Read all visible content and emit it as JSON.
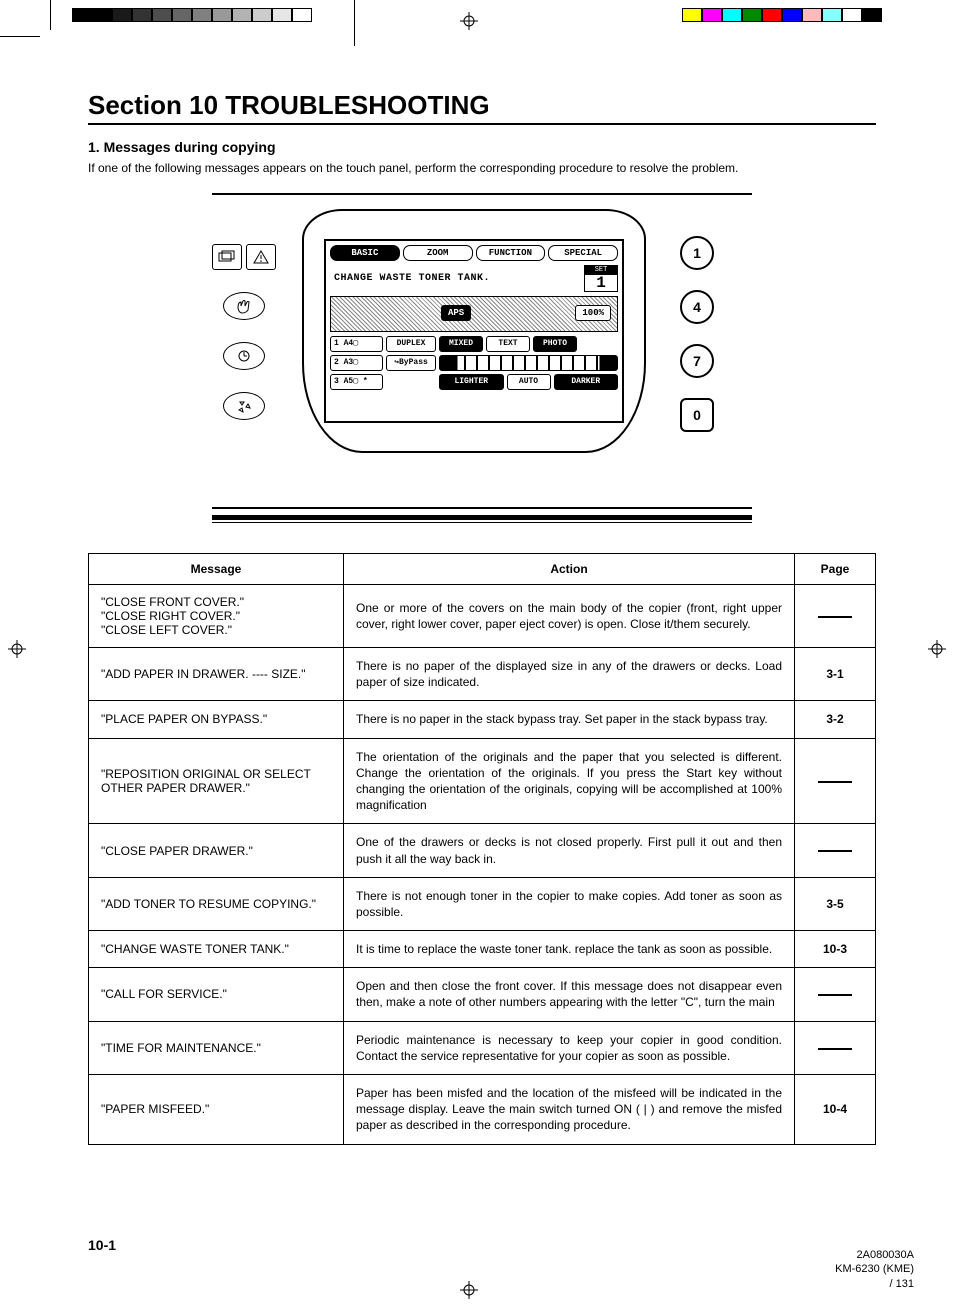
{
  "header": {
    "section_title": "Section 10  TROUBLESHOOTING",
    "sub_heading": "1. Messages during copying",
    "intro_text": "If one of the following messages appears on the touch panel, perform the corresponding procedure to resolve the problem."
  },
  "panel": {
    "tabs": [
      "BASIC",
      "ZOOM",
      "FUNCTION",
      "SPECIAL"
    ],
    "active_tab": 0,
    "message": "CHANGE WASTE TONER TANK.",
    "set_label": "SET",
    "set_value": "1",
    "aps_label": "APS",
    "ratio_label": "100%",
    "paper_slots": [
      "1 A4▢",
      "2 A3▢",
      "3 A5▢ *"
    ],
    "options_row1": [
      "DUPLEX",
      "MIXED",
      "TEXT",
      "PHOTO"
    ],
    "options_row2_left": "↪ByPass",
    "options_row3": [
      "LIGHTER",
      "AUTO",
      "DARKER"
    ],
    "left_icons": [
      "page-stack-icon",
      "hand-icon",
      "clock-icon",
      "recycle-icon"
    ],
    "num_buttons": [
      "1",
      "4",
      "7",
      "0"
    ]
  },
  "table": {
    "headers": {
      "message": "Message",
      "action": "Action",
      "page": "Page"
    },
    "rows": [
      {
        "message": "\"CLOSE FRONT COVER.\"\n\"CLOSE RIGHT COVER.\"\n\"CLOSE LEFT COVER.\"",
        "action": "One or more of the covers on the main body of the copier (front, right upper cover, right lower cover, paper eject cover) is open. Close it/them securely.",
        "page": ""
      },
      {
        "message": "\"ADD PAPER IN DRAWER. ---- SIZE.\"",
        "action": "There is no paper of the displayed size in any of the drawers or decks. Load paper of size indicated.",
        "page": "3-1"
      },
      {
        "message": "\"PLACE PAPER ON BYPASS.\"",
        "action": "There is no paper in the stack bypass tray. Set paper in the stack bypass tray.",
        "page": "3-2"
      },
      {
        "message": "\"REPOSITION ORIGINAL OR SELECT OTHER PAPER DRAWER.\"",
        "action": "The orientation of the originals and the paper that you selected is different. Change the orientation of the originals. If you press the Start key without changing the orientation of the originals, copying will be accomplished at 100% magnification",
        "page": ""
      },
      {
        "message": "\"CLOSE PAPER DRAWER.\"",
        "action": "One of the drawers or decks is not closed properly. First pull it out and then push it all the way back in.",
        "page": ""
      },
      {
        "message": "\"ADD TONER TO RESUME COPYING.\"",
        "action": "There is not enough toner in the copier to make copies. Add toner as soon as possible.",
        "page": "3-5"
      },
      {
        "message": "\"CHANGE WASTE TONER TANK.\"",
        "action": "It is time to replace the waste toner tank. replace the tank as soon as possible.",
        "page": "10-3"
      },
      {
        "message": "\"CALL FOR SERVICE.\"",
        "action": "Open and then close the front cover. If this message does not disappear even then, make a note of other numbers appearing with the letter \"C\", turn the main",
        "page": ""
      },
      {
        "message": "\"TIME FOR MAINTENANCE.\"",
        "action": "Periodic maintenance is necessary to keep your copier in good condition. Contact the service representative for your copier as soon as possible.",
        "page": ""
      },
      {
        "message": "\"PAPER MISFEED.\"",
        "action": "Paper has been misfed and the location of the misfeed will be indicated in the message display. Leave the main switch turned ON ( | ) and remove the misfed paper as described in the corresponding procedure.",
        "page": "10-4"
      }
    ]
  },
  "page_number": "10-1",
  "footer": {
    "code1": "2A080030A",
    "code2": "KM-6230 (KME)",
    "code3": "/ 131"
  },
  "colorbar_left": [
    "#000",
    "#000",
    "#1a1a1a",
    "#333",
    "#4d4d4d",
    "#666",
    "#808080",
    "#999",
    "#b3b3b3",
    "#ccc",
    "#e6e6e6",
    "#fff"
  ],
  "colorbar_right": [
    "#ff0",
    "#f0f",
    "#0ff",
    "#080",
    "#f00",
    "#00f",
    "#fbb",
    "#8ff",
    "#fff",
    "#000"
  ]
}
